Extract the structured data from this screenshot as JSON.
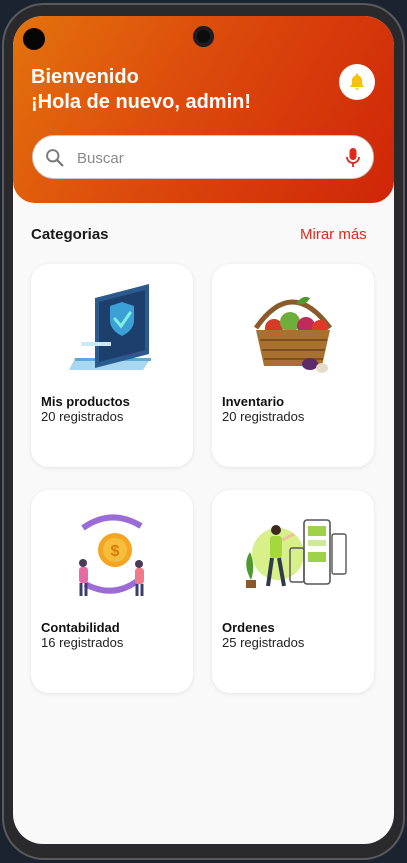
{
  "header": {
    "greeting": "Bienvenido",
    "subtitle": "¡Hola de nuevo, admin!"
  },
  "icons": {
    "notifications": "bell-icon",
    "search": "search-icon",
    "voice": "mic-icon"
  },
  "colors": {
    "header_start": "#e4720d",
    "header_end": "#cf2508",
    "accent": "#e0281b",
    "bell": "#f5c400"
  },
  "search": {
    "placeholder": "Buscar"
  },
  "categories": {
    "title": "Categorias",
    "see_more": "Mirar más",
    "items": [
      {
        "name": "Mis productos",
        "count": "20 registrados"
      },
      {
        "name": "Inventario",
        "count": "20 registrados"
      },
      {
        "name": "Contabilidad",
        "count": "16 registrados"
      },
      {
        "name": "Ordenes",
        "count": "25 registrados"
      }
    ]
  }
}
